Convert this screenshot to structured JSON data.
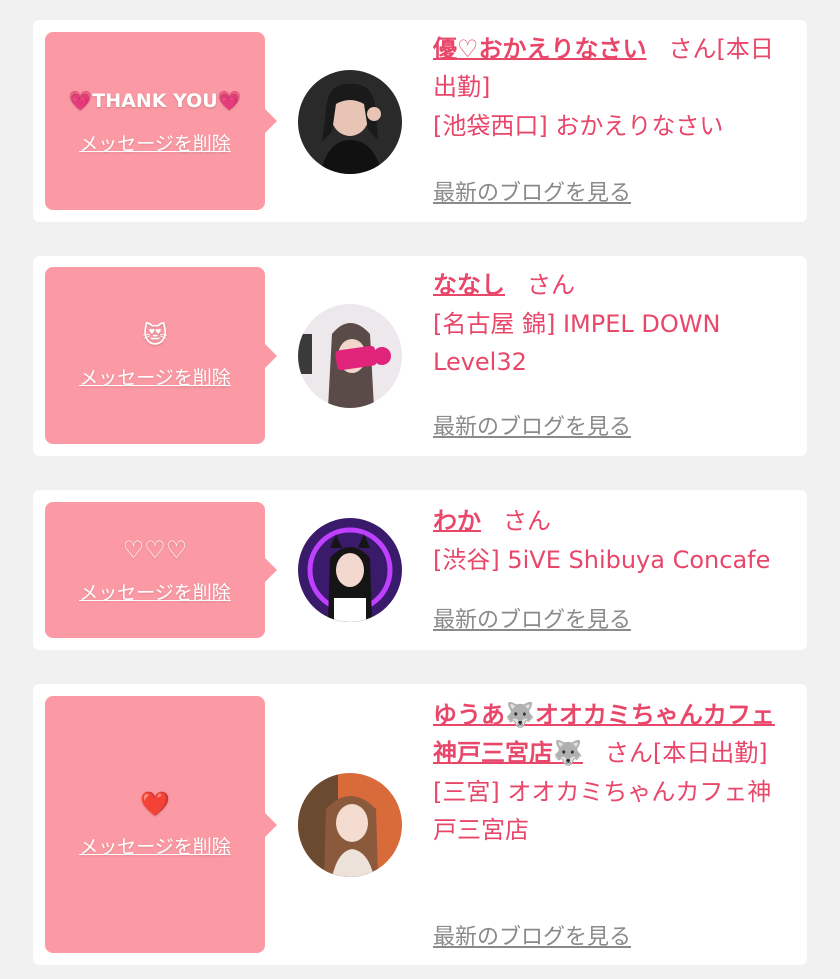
{
  "delete_label": "メッセージを削除",
  "san_label": "さん",
  "blog_label": "最新のブログを見る",
  "colors": {
    "accent": "#e8476a",
    "bubble": "#fb9aa4",
    "background": "#f1f1f1",
    "card": "#ffffff",
    "link_gray": "#8a8a8a"
  },
  "entries": [
    {
      "message": "💗THANK YOU💗",
      "name": "優♡おかえりなさい",
      "status": "[本日出勤]",
      "shop": "[池袋西口] おかえりなさい",
      "avatar_icon": "avatar-photo"
    },
    {
      "message": "😻",
      "name": "ななし",
      "status": "",
      "shop": "[名古屋 錦] IMPEL DOWN Level32",
      "avatar_icon": "avatar-photo"
    },
    {
      "message": "♡♡♡",
      "name": "わか",
      "status": "",
      "shop": "[渋谷] 5iVE Shibuya Concafe",
      "avatar_icon": "avatar-photo"
    },
    {
      "message": "❤️",
      "name": "ゆうあ🐺オオカミちゃんカフェ神戸三宮店🐺",
      "status": "[本日出勤]",
      "shop": "[三宮] オオカミちゃんカフェ神戸三宮店",
      "avatar_icon": "avatar-photo"
    }
  ]
}
